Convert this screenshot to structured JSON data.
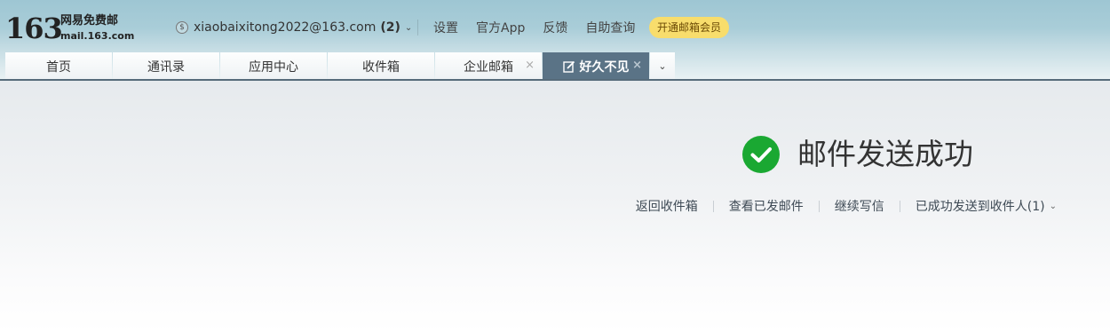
{
  "header": {
    "logo_number": "163",
    "logo_name": "网易免费邮",
    "logo_domain": "mail.163.com",
    "account": {
      "email": "xiaobaixitong2022@163.com",
      "unread_count": "(2)",
      "coin_icon": "coin-icon",
      "dropdown_icon": "chevron-down-icon"
    },
    "links": {
      "settings": "设置",
      "official_app": "官方App",
      "feedback": "反馈",
      "self_service": "自助查询"
    },
    "vip_label": "开通邮箱会员",
    "vip_color": "#f8dd6c"
  },
  "tabs": {
    "home": "首页",
    "contacts": "通讯录",
    "app_center": "应用中心",
    "inbox": "收件箱",
    "enterprise_mail": "企业邮箱",
    "active": "好久不见",
    "active_color": "#5a7386",
    "close_symbol": "×",
    "more_icon": "chevron-down-icon"
  },
  "main": {
    "success_message": "邮件发送成功",
    "success_color": "#1aa832",
    "actions": {
      "back_to_inbox": "返回收件箱",
      "view_sent": "查看已发邮件",
      "continue_writing": "继续写信",
      "sent_to_recipients": "已成功发送到收件人(1)"
    }
  }
}
